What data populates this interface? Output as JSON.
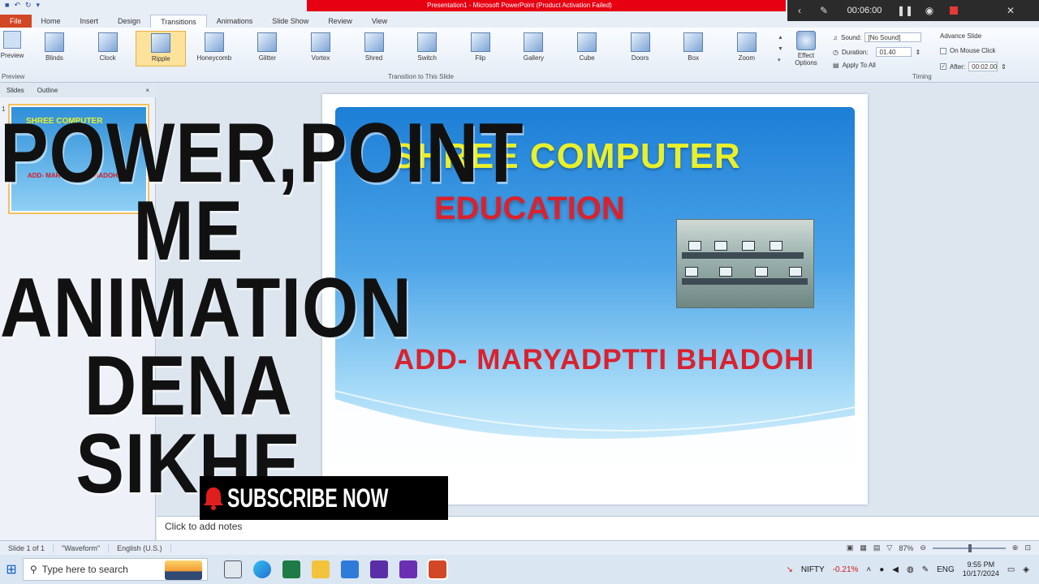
{
  "window": {
    "title": "Presentation1 - Microsoft PowerPoint (Product Activation Failed)"
  },
  "recorder": {
    "time": "00:06:00"
  },
  "ribbon": {
    "tabs": [
      "File",
      "Home",
      "Insert",
      "Design",
      "Transitions",
      "Animations",
      "Slide Show",
      "Review",
      "View"
    ],
    "active_tab": "Transitions",
    "preview_label": "Preview",
    "preview_group_label": "Preview",
    "transitions": [
      "Blinds",
      "Clock",
      "Ripple",
      "Honeycomb",
      "Glitter",
      "Vortex",
      "Shred",
      "Switch",
      "Flip",
      "Gallery",
      "Cube",
      "Doors",
      "Box",
      "Zoom"
    ],
    "selected_transition": "Ripple",
    "transitions_group_label": "Transition to This Slide",
    "effect_options_label": "Effect Options",
    "timing": {
      "sound_label": "Sound:",
      "sound_value": "[No Sound]",
      "duration_label": "Duration:",
      "duration_value": "01.40",
      "apply_all_label": "Apply To All",
      "advance_label": "Advance Slide",
      "on_click_label": "On Mouse Click",
      "after_label": "After:",
      "after_value": "00:02.00",
      "group_label": "Timing"
    }
  },
  "pane": {
    "tab_slides": "Slides",
    "tab_outline": "Outline",
    "close": "×",
    "thumb_number": "1",
    "thumb_title": "SHREE COMPUTER",
    "thumb_addr": "ADD- MARYADPTTI BHADOHI"
  },
  "slide": {
    "title": "SHREE COMPUTER",
    "subtitle": "EDUCATION",
    "address": "ADD- MARYADPTTI BHADOHI"
  },
  "overlay": {
    "lines": [
      "POWER,POINT",
      "ME",
      "ANIMATION",
      "DENA SIKHE"
    ],
    "subscribe": "SUBSCRIBE NOW"
  },
  "notes": {
    "placeholder": "Click to add notes"
  },
  "status": {
    "slide": "Slide 1 of 1",
    "theme": "\"Waveform\"",
    "language": "English (U.S.)",
    "zoom": "87%"
  },
  "taskbar": {
    "search_placeholder": "Type here to search",
    "nifty_label": "NIFTY",
    "nifty_change": "-0.21%",
    "lang": "ENG",
    "time": "9:55 PM",
    "date": "10/17/2024"
  },
  "colors": {
    "accent": "#2b579a",
    "file_tab": "#d24726",
    "slide_title": "#e8f02c",
    "slide_red": "#d9222f"
  }
}
